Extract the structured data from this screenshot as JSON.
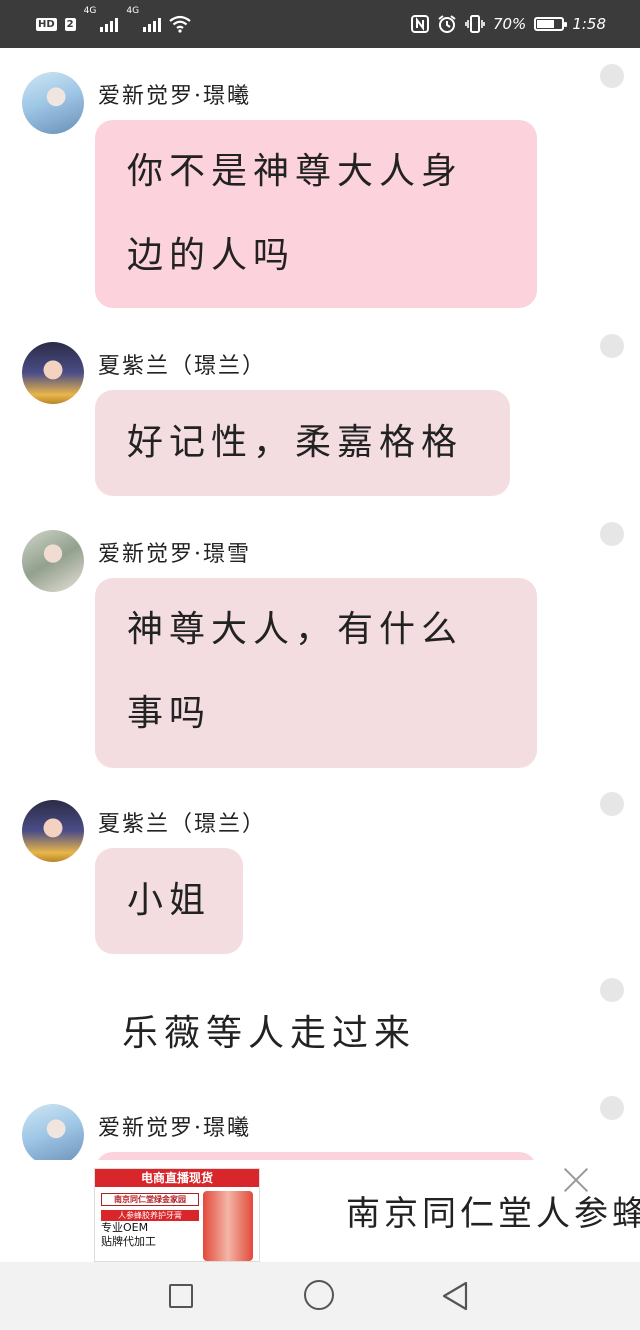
{
  "status_bar": {
    "hd_badge": "HD",
    "sim_label": "2",
    "signal1_label": "4G",
    "signal2_label": "4G",
    "battery_text": "70%",
    "battery_level": 0.7,
    "time": "1:58",
    "icons": [
      "nfc-icon",
      "alarm-icon",
      "vibrate-icon",
      "battery-icon"
    ]
  },
  "messages": [
    {
      "type": "bubble",
      "sender": "爱新觉罗·璟曦",
      "avatar": "avatar-girl-white-robe",
      "bubble_color": "#fcd2dc",
      "lines": [
        "你不是神尊大人身",
        "边的人吗"
      ]
    },
    {
      "type": "bubble",
      "sender": "夏紫兰（璟兰）",
      "avatar": "avatar-girl-qing-headdress",
      "bubble_color": "#f3dde1",
      "lines": [
        "好记性，柔嘉格格"
      ]
    },
    {
      "type": "bubble",
      "sender": "爱新觉罗·璟雪",
      "avatar": "avatar-girl-green",
      "bubble_color": "#f3dde1",
      "lines": [
        "神尊大人，有什么",
        "事吗"
      ]
    },
    {
      "type": "bubble",
      "sender": "夏紫兰（璟兰）",
      "avatar": "avatar-girl-qing-headdress",
      "bubble_color": "#f3dde1",
      "lines": [
        "小姐"
      ]
    },
    {
      "type": "narration",
      "text": "乐薇等人走过来"
    },
    {
      "type": "bubble",
      "sender": "爱新觉罗·璟曦",
      "avatar": "avatar-girl-white-robe",
      "bubble_color": "#fcd2dc",
      "lines": [
        ""
      ]
    }
  ],
  "ad": {
    "image_banner": "电商直播现货",
    "image_brand": "南京同仁堂绿金家园",
    "image_red_line": "人参蜂胶养护牙膏",
    "image_line1": "专业OEM",
    "image_line2": "贴牌代加工",
    "title": "南京同仁堂人参蜂"
  },
  "nav_bar": {
    "buttons": [
      "recent-apps-button",
      "home-button",
      "back-button"
    ]
  }
}
